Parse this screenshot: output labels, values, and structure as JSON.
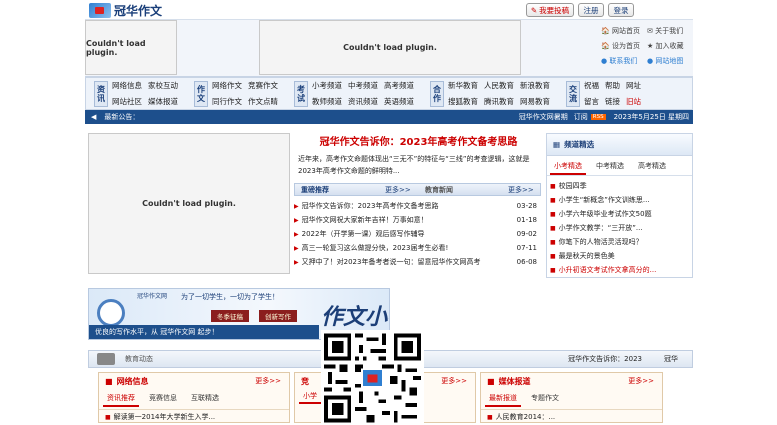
{
  "header": {
    "logo_text": "冠华作文",
    "btn_submit": "我要投稿",
    "btn_register": "注册",
    "btn_login": "登录",
    "links": [
      "网站首页",
      "关于我们",
      "设为首页",
      "加入收藏",
      "联系我们",
      "网站地图"
    ]
  },
  "plugin_text": "Couldn't load plugin.",
  "nav": [
    {
      "tag": "资讯",
      "items": [
        "网络信息",
        "家校互动",
        "网站社区",
        "媒体报道"
      ]
    },
    {
      "tag": "作文",
      "items": [
        "网络作文",
        "竞赛作文",
        "同行作文",
        "作文点睛"
      ]
    },
    {
      "tag": "考试",
      "items": [
        "小考频道",
        "中考频道",
        "高考频道",
        "教师频道",
        "资讯频道",
        "英语频道"
      ]
    },
    {
      "tag": "合作",
      "items": [
        "新华教育",
        "人民教育",
        "新浪教育",
        "搜狐教育",
        "腾讯教育",
        "网易教育"
      ]
    },
    {
      "tag": "交流",
      "items": [
        "祝福",
        "帮助",
        "网址",
        "留言",
        "链接",
        "旧站"
      ]
    }
  ],
  "notice": {
    "label": "最新公告：",
    "right_text": "冠华作文网暑期",
    "subscribe": "订阅",
    "rss": "RSS",
    "date": "2023年5月25日 星期四"
  },
  "feature": {
    "title": "冠华作文告诉你：2023年高考作文备考思路",
    "summary": "近年来，高考作文命题体现出“三无不”的特征与“三线”的考查逻辑，这就是2023年高考作文命题的鲜明特..."
  },
  "recommend": {
    "title": "重磅推荐",
    "more": "更多>>",
    "items": [
      {
        "text": "冠华作文告诉你：2023年高考作文备考思路",
        "date": "03-28"
      },
      {
        "text": "冠华作文网祝大家新年吉祥！万事如意！",
        "date": "01-18"
      },
      {
        "text": "2022年（开学第一课）观后感写作辅导",
        "date": "09-02"
      },
      {
        "text": "高三一轮复习这么做提分快，2023届考生必看!",
        "date": "07-11"
      },
      {
        "text": "又押中了！对2023年备考者说一句：留意冠华作文网高考",
        "date": "06-08"
      }
    ]
  },
  "news": {
    "title": "教育新闻",
    "more": "更多>>"
  },
  "picks": {
    "title": "频道精选",
    "tabs": [
      "小考精选",
      "中考精选",
      "高考精选"
    ],
    "items": [
      "校园四季",
      "小学生“新概念”作文训练思...",
      "小学六年级毕业考试作文50题",
      "小学作文教学：“三开放”...",
      "你笔下的人物活灵活现吗？",
      "最是秋天的景色美",
      "小升初语文考试作文拿高分的..."
    ]
  },
  "banner": {
    "top_left": "冠华作文网",
    "slogan": "为了一切学生，一切为了学生！",
    "tag1": "冬季征稿",
    "tag2": "创新写作",
    "bottom": "优良的写作水平，从 冠华作文网 起步！",
    "big": "作文小考"
  },
  "lower": {
    "strip_label": "教育动态",
    "strip_right": "冠华作文告诉你：2023",
    "strip_far": "冠华",
    "box1": {
      "title": "网络信息",
      "more": "更多>>",
      "tabs": [
        "资讯推荐",
        "竞赛信息",
        "互联精选"
      ],
      "line": "解读第一2014年大学新生入学..."
    },
    "box2": {
      "title": "竞",
      "more": "更多>>",
      "tabs": [
        "小学"
      ]
    },
    "box3": {
      "title": "媒体报道",
      "more": "更多>>",
      "tabs": [
        "最新报道",
        "专题作文"
      ],
      "line": "人民教育2014：..."
    }
  },
  "colors": {
    "accent": "#cc0000",
    "nav_bg": "#eef3fa",
    "link_blue": "#1c3f78"
  }
}
